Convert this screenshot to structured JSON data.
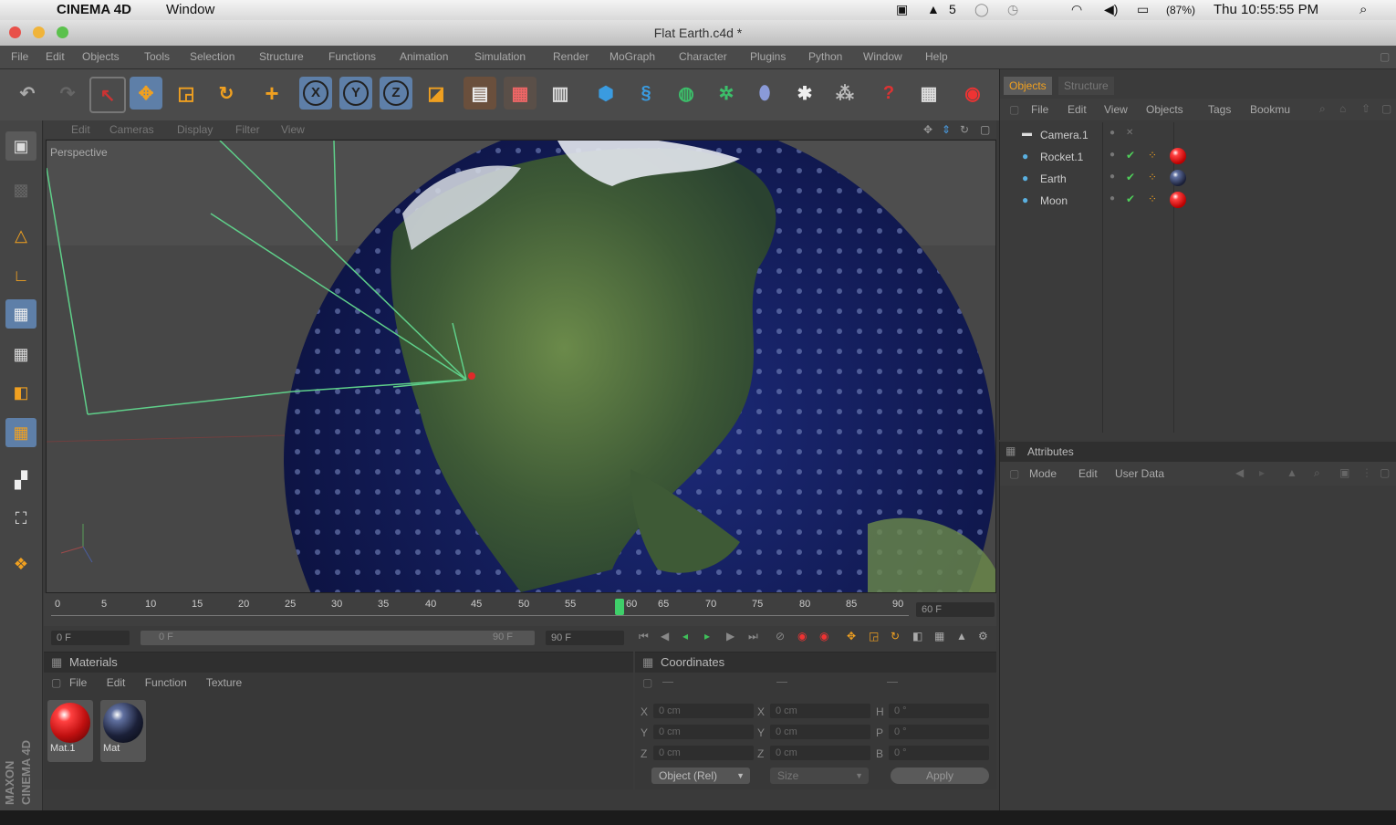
{
  "mac_menubar": {
    "app": "CINEMA 4D",
    "menu": "Window",
    "clock": "Thu 10:55:55 PM",
    "battery": "(87%)",
    "icons": [
      "camera-icon",
      "adobe-icon",
      "circle-icon",
      "clock-icon",
      "wifi-icon",
      "volume-icon",
      "battery-icon",
      "search-icon"
    ],
    "adobe_count": "5"
  },
  "window": {
    "title": "Flat Earth.c4d *"
  },
  "c4d_menu": [
    "File",
    "Edit",
    "Objects",
    "Tools",
    "Selection",
    "Structure",
    "Functions",
    "Animation",
    "Simulation",
    "Render",
    "MoGraph",
    "Character",
    "Plugins",
    "Python",
    "Window",
    "Help"
  ],
  "toolbar": {
    "axis_x": "X",
    "axis_y": "Y",
    "axis_z": "Z"
  },
  "viewport": {
    "menu": [
      "Edit",
      "Cameras",
      "Display",
      "Filter",
      "View"
    ],
    "label": "Perspective"
  },
  "timeline": {
    "ticks": [
      "0",
      "5",
      "10",
      "15",
      "20",
      "25",
      "30",
      "35",
      "40",
      "45",
      "50",
      "55",
      "60",
      "65",
      "70",
      "75",
      "80",
      "85",
      "90"
    ],
    "current_frame": 60,
    "end_label": "60 F",
    "start_field": "0 F",
    "range_start": "0 F",
    "range_end": "90 F",
    "end_field": "90 F"
  },
  "materials": {
    "title": "Materials",
    "menu": [
      "File",
      "Edit",
      "Function",
      "Texture"
    ],
    "items": [
      {
        "name": "Mat.1",
        "color": "#d41010"
      },
      {
        "name": "Mat",
        "color": "#1b2038"
      }
    ]
  },
  "coordinates": {
    "title": "Coordinates",
    "rows": [
      {
        "a": "X",
        "av": "0 cm",
        "b": "X",
        "bv": "0 cm",
        "c": "H",
        "cv": "0 °"
      },
      {
        "a": "Y",
        "av": "0 cm",
        "b": "Y",
        "bv": "0 cm",
        "c": "P",
        "cv": "0 °"
      },
      {
        "a": "Z",
        "av": "0 cm",
        "b": "Z",
        "bv": "0 cm",
        "c": "B",
        "cv": "0 °"
      }
    ],
    "mode_select": "Object (Rel)",
    "size_select": "Size",
    "apply": "Apply"
  },
  "objects_panel": {
    "tabs": [
      "Objects",
      "Structure"
    ],
    "menu": [
      "File",
      "Edit",
      "View",
      "Objects",
      "Tags",
      "Bookmu"
    ],
    "items": [
      {
        "name": "Camera.1",
        "tag": ""
      },
      {
        "name": "Rocket.1",
        "tag": "#d41010"
      },
      {
        "name": "Earth",
        "tag": "#1b2038"
      },
      {
        "name": "Moon",
        "tag": "#d41010"
      }
    ]
  },
  "attributes_panel": {
    "title": "Attributes",
    "menu": [
      "Mode",
      "Edit",
      "User Data"
    ]
  },
  "brand": "MAXON CINEMA 4D"
}
